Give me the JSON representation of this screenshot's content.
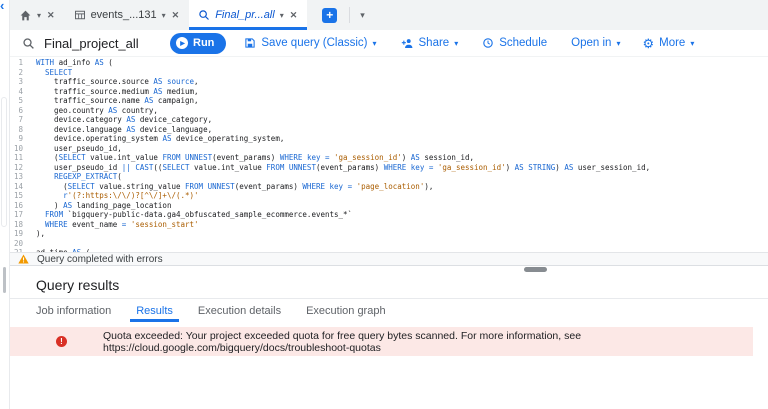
{
  "colors": {
    "accent_blue": "#1a73e8",
    "tab_bg": "#f1f3f4",
    "keyword": "#1967d2",
    "string": "#aa5d00",
    "error_red": "#d93025",
    "error_bg": "#fce8e6",
    "warning_orange": "#f29900"
  },
  "tab_strip": {
    "events_tab_label": "events_...131",
    "query_tab_label": "Final_pr...all"
  },
  "toolbar": {
    "query_title": "Final_project_all",
    "run_label": "Run",
    "save_label": "Save query (Classic)",
    "share_label": "Share",
    "schedule_label": "Schedule",
    "open_in_label": "Open in",
    "more_label": "More"
  },
  "editor": {
    "lines": [
      {
        "n": 1,
        "tokens": [
          [
            "WITH",
            "k"
          ],
          [
            " ad_info ",
            "i"
          ],
          [
            "AS",
            "k"
          ],
          [
            " (",
            "i"
          ]
        ]
      },
      {
        "n": 2,
        "tokens": [
          [
            "  ",
            "i"
          ],
          [
            "SELECT",
            "k"
          ]
        ]
      },
      {
        "n": 3,
        "tokens": [
          [
            "    traffic_source.source ",
            "i"
          ],
          [
            "AS",
            "k"
          ],
          [
            " ",
            "i"
          ],
          [
            "source",
            "k"
          ],
          [
            ",",
            "i"
          ]
        ]
      },
      {
        "n": 4,
        "tokens": [
          [
            "    traffic_source.medium ",
            "i"
          ],
          [
            "AS",
            "k"
          ],
          [
            " medium,",
            "i"
          ]
        ]
      },
      {
        "n": 5,
        "tokens": [
          [
            "    traffic_source.name ",
            "i"
          ],
          [
            "AS",
            "k"
          ],
          [
            " campaign,",
            "i"
          ]
        ]
      },
      {
        "n": 6,
        "tokens": [
          [
            "    geo.country ",
            "i"
          ],
          [
            "AS",
            "k"
          ],
          [
            " country,",
            "i"
          ]
        ]
      },
      {
        "n": 7,
        "tokens": [
          [
            "    device.category ",
            "i"
          ],
          [
            "AS",
            "k"
          ],
          [
            " device_category,",
            "i"
          ]
        ]
      },
      {
        "n": 8,
        "tokens": [
          [
            "    device.language ",
            "i"
          ],
          [
            "AS",
            "k"
          ],
          [
            " device_language,",
            "i"
          ]
        ]
      },
      {
        "n": 9,
        "tokens": [
          [
            "    device.operating_system ",
            "i"
          ],
          [
            "AS",
            "k"
          ],
          [
            " device_operating_system,",
            "i"
          ]
        ]
      },
      {
        "n": 10,
        "tokens": [
          [
            "    user_pseudo_id,",
            "i"
          ]
        ]
      },
      {
        "n": 11,
        "tokens": [
          [
            "    (",
            "i"
          ],
          [
            "SELECT",
            "k"
          ],
          [
            " value.int_value ",
            "i"
          ],
          [
            "FROM",
            "k"
          ],
          [
            " ",
            "i"
          ],
          [
            "UNNEST",
            "k"
          ],
          [
            "(event_params) ",
            "i"
          ],
          [
            "WHERE",
            "k"
          ],
          [
            " ",
            "i"
          ],
          [
            "key",
            "k"
          ],
          [
            " ",
            "i"
          ],
          [
            "=",
            "k"
          ],
          [
            " ",
            "i"
          ],
          [
            "'ga_session_id'",
            "s"
          ],
          [
            ") ",
            "i"
          ],
          [
            "AS",
            "k"
          ],
          [
            " session_id,",
            "i"
          ]
        ]
      },
      {
        "n": 12,
        "tokens": [
          [
            "    user_pseudo_id ",
            "i"
          ],
          [
            "||",
            "k"
          ],
          [
            " ",
            "i"
          ],
          [
            "CAST",
            "k"
          ],
          [
            "((",
            "i"
          ],
          [
            "SELECT",
            "k"
          ],
          [
            " value.int_value ",
            "i"
          ],
          [
            "FROM",
            "k"
          ],
          [
            " ",
            "i"
          ],
          [
            "UNNEST",
            "k"
          ],
          [
            "(event_params) ",
            "i"
          ],
          [
            "WHERE",
            "k"
          ],
          [
            " ",
            "i"
          ],
          [
            "key",
            "k"
          ],
          [
            " ",
            "i"
          ],
          [
            "=",
            "k"
          ],
          [
            " ",
            "i"
          ],
          [
            "'ga_session_id'",
            "s"
          ],
          [
            ") ",
            "i"
          ],
          [
            "AS",
            "k"
          ],
          [
            " ",
            "i"
          ],
          [
            "STRING",
            "k"
          ],
          [
            ") ",
            "i"
          ],
          [
            "AS",
            "k"
          ],
          [
            " user_session_id,",
            "i"
          ]
        ]
      },
      {
        "n": 13,
        "tokens": [
          [
            "    ",
            "i"
          ],
          [
            "REGEXP_EXTRACT",
            "k"
          ],
          [
            "(",
            "i"
          ]
        ]
      },
      {
        "n": 14,
        "tokens": [
          [
            "      (",
            "i"
          ],
          [
            "SELECT",
            "k"
          ],
          [
            " value.string_value ",
            "i"
          ],
          [
            "FROM",
            "k"
          ],
          [
            " ",
            "i"
          ],
          [
            "UNNEST",
            "k"
          ],
          [
            "(event_params) ",
            "i"
          ],
          [
            "WHERE",
            "k"
          ],
          [
            " ",
            "i"
          ],
          [
            "key",
            "k"
          ],
          [
            " ",
            "i"
          ],
          [
            "=",
            "k"
          ],
          [
            " ",
            "i"
          ],
          [
            "'page_location'",
            "s"
          ],
          [
            "),",
            "i"
          ]
        ]
      },
      {
        "n": 15,
        "tokens": [
          [
            "      ",
            "i"
          ],
          [
            "r",
            "k"
          ],
          [
            "'(?:https:\\/\\/)?[^\\/]+\\/(.*)'",
            "s"
          ]
        ]
      },
      {
        "n": 16,
        "tokens": [
          [
            "    ) ",
            "i"
          ],
          [
            "AS",
            "k"
          ],
          [
            " landing_page_location",
            "i"
          ]
        ]
      },
      {
        "n": 17,
        "tokens": [
          [
            "  ",
            "i"
          ],
          [
            "FROM",
            "k"
          ],
          [
            " ",
            "i"
          ],
          [
            "`bigquery-public-data.ga4_obfuscated_sample_ecommerce.events_*`",
            "t"
          ]
        ]
      },
      {
        "n": 18,
        "tokens": [
          [
            "  ",
            "i"
          ],
          [
            "WHERE",
            "k"
          ],
          [
            " event_name ",
            "i"
          ],
          [
            "=",
            "k"
          ],
          [
            " ",
            "i"
          ],
          [
            "'session_start'",
            "s"
          ]
        ]
      },
      {
        "n": 19,
        "tokens": [
          [
            "),",
            "i"
          ]
        ]
      },
      {
        "n": 20,
        "tokens": []
      },
      {
        "n": 21,
        "tokens": [
          [
            "ad_time ",
            "i"
          ],
          [
            "AS",
            "k"
          ],
          [
            " (",
            "i"
          ]
        ]
      }
    ]
  },
  "status": {
    "message": "Query completed with errors"
  },
  "results": {
    "header": "Query results",
    "tabs": [
      {
        "label": "Job information",
        "active": false
      },
      {
        "label": "Results",
        "active": true
      },
      {
        "label": "Execution details",
        "active": false
      },
      {
        "label": "Execution graph",
        "active": false
      }
    ],
    "error_message": "Quota exceeded: Your project exceeded quota for free query bytes scanned. For more information, see https://cloud.google.com/bigquery/docs/troubleshoot-quotas"
  }
}
